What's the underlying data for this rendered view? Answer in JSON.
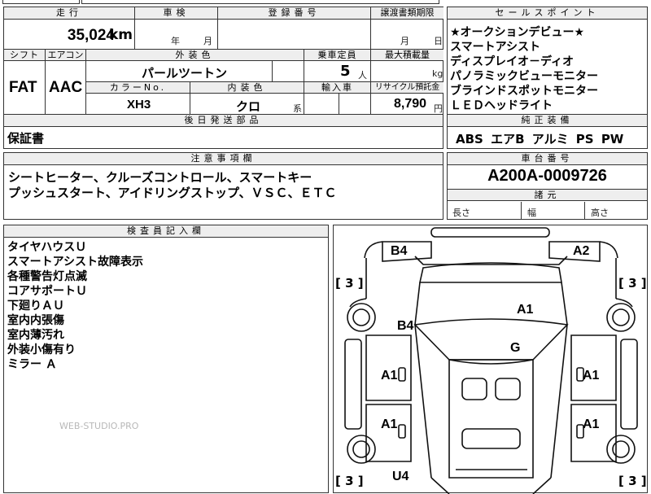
{
  "table_headers": {
    "mileage": "走行",
    "inspection": "車検",
    "registration": "登録番号",
    "transfer_deadline": "譲渡書類期限",
    "shift": "シフト",
    "aircon": "エアコン",
    "exterior_color": "外装色",
    "seating": "乗車定員",
    "max_load": "最大積載量",
    "color_no": "カラーNo.",
    "interior_color": "内装色",
    "import": "輸入車",
    "recycle_fee": "リサイクル預託金",
    "later_parts": "後日発送部品",
    "selling_points": "セールスポイント",
    "genuine_equipment": "純正装備",
    "notes": "注意事項欄",
    "chassis_number": "車台番号",
    "dimensions": "諸元",
    "inspector": "検査員記入欄"
  },
  "values": {
    "mileage": "35,024",
    "mileage_unit": "km",
    "inspection_year": "年",
    "inspection_month": "月",
    "transfer_month": "月",
    "transfer_day": "日",
    "shift": "FAT",
    "aircon": "AAC",
    "exterior_color": "パールツートン",
    "seating": "5",
    "seating_unit": "人",
    "max_load_unit": "kg",
    "color_no": "XH3",
    "interior_color": "クロ",
    "interior_suffix": "系",
    "recycle_fee": "8,790",
    "recycle_unit": "円",
    "later_parts": "保証書",
    "genuine_equipment": "ABS エアB アルミ PS PW",
    "chassis_number": "A200A-0009726",
    "length_label": "長さ",
    "width_label": "幅",
    "height_label": "高さ"
  },
  "selling_points": [
    "★オークションデビュー★",
    "スマートアシスト",
    "ディスプレイオ－ディオ",
    "パノラミックビューモニター",
    "ブラインドスポットモニター",
    "ＬＥＤヘッドライト"
  ],
  "notes": [
    "シートヒーター、クルーズコントロール、スマートキー",
    "プッシュスタート、アイドリングストップ、ＶＳＣ、ＥＴＣ"
  ],
  "inspector_notes": [
    "タイヤハウスＵ",
    "スマートアシスト故障表示",
    "各種警告灯点滅",
    "コアサポートＵ",
    "下廻りＡＵ",
    "室内内張傷",
    "室内薄汚れ",
    "外装小傷有り",
    "ミラー Ａ"
  ],
  "damage_codes": {
    "front_left": "B4",
    "front_right": "A2",
    "hood": "A1",
    "left_fender": "B4",
    "windshield": "G",
    "left_front_door": "A1",
    "right_front_door": "A1",
    "left_rear_door": "A1",
    "right_rear_door": "A1",
    "rear_left": "U4"
  },
  "tire_brackets": {
    "front_left": "[ 3 ]",
    "front_right": "[ 3 ]",
    "rear_left": "[ 3 ]",
    "rear_right": "[ 3 ]"
  },
  "watermark": "WEB-STUDIO.PRO"
}
